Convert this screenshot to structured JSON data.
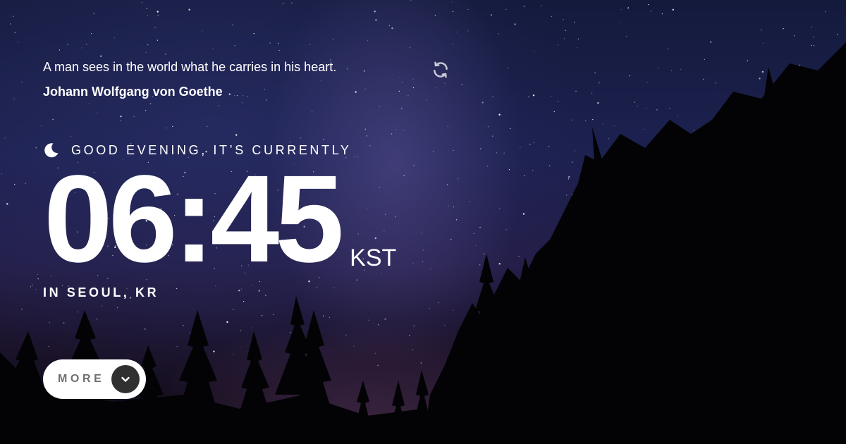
{
  "quote": {
    "text": "A man sees in the world what he carries in his heart.",
    "author": "Johann Wolfgang von Goethe"
  },
  "refresh_icon": "refresh-icon",
  "greeting": {
    "icon": "moon-icon",
    "text": "GOOD EVENING, IT’S CURRENTLY"
  },
  "clock": {
    "time": "06:45",
    "timezone": "KST"
  },
  "location": "IN SEOUL, KR",
  "more_button": {
    "label": "MORE",
    "icon": "chevron-down-icon"
  },
  "colors": {
    "text": "#ffffff",
    "button_bg": "#ffffff",
    "button_label": "#6f6f6f",
    "chevron_bg": "#303030",
    "sky_top": "#141a3c"
  }
}
